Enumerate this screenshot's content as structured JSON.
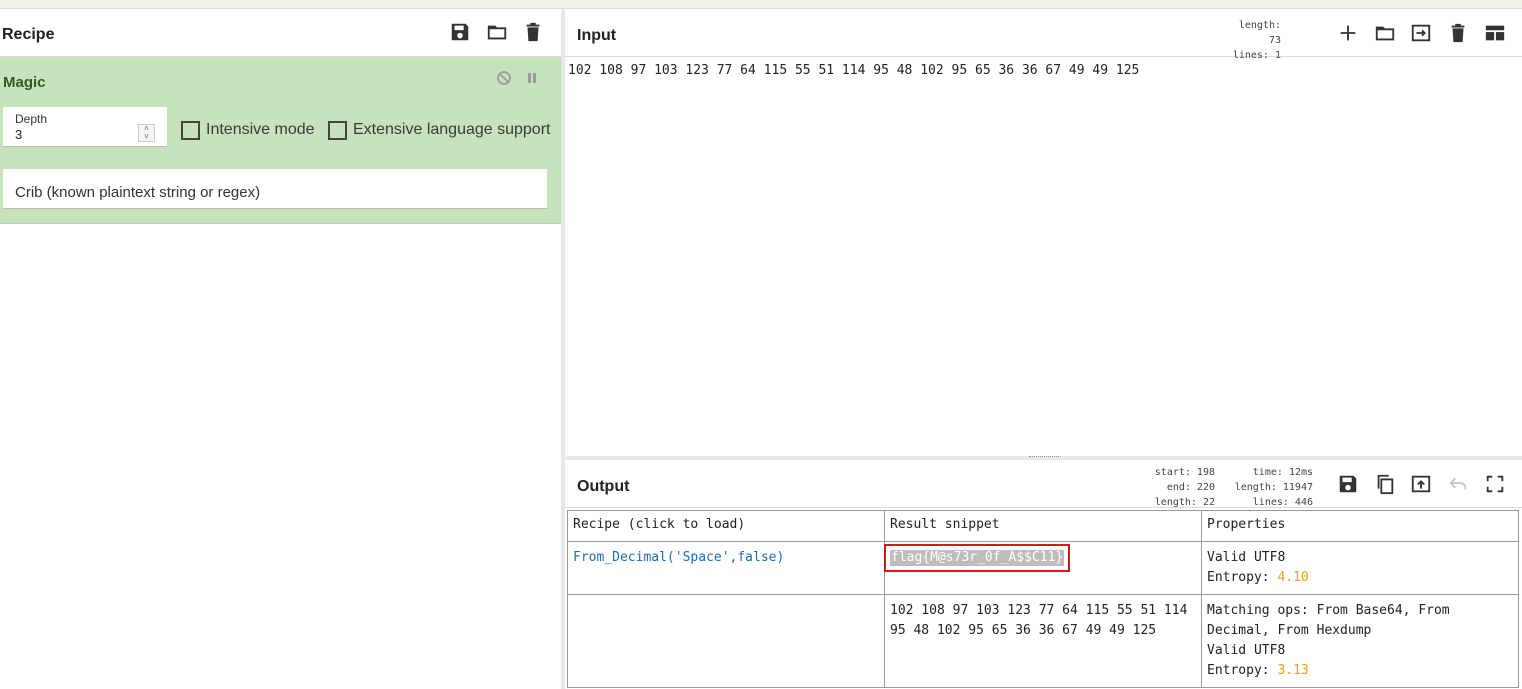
{
  "recipe": {
    "title": "Recipe",
    "icons": [
      "save-icon",
      "folder-icon",
      "trash-icon"
    ],
    "operation": {
      "name": "Magic",
      "depth_label": "Depth",
      "depth_value": "3",
      "intensive_label": "Intensive mode",
      "extensive_label": "Extensive language support",
      "crib_placeholder": "Crib (known plaintext string or regex)"
    }
  },
  "input": {
    "title": "Input",
    "stats": {
      "length": "length: 73",
      "lines": "lines:  1"
    },
    "text": "102 108 97 103 123 77 64 115 55 51 114 95 48 102 95 65 36 36 67 49 49 125"
  },
  "output": {
    "title": "Output",
    "stats_left": {
      "start": "start: 198",
      "end": "end: 220",
      "length": "length:  22"
    },
    "stats_right": {
      "time": "time:  12ms",
      "length": "length: 11947",
      "lines": "lines:   446"
    },
    "table": {
      "headers": [
        "Recipe (click to load)",
        "Result snippet",
        "Properties"
      ],
      "rows": [
        {
          "recipe": "From_Decimal('Space',false)",
          "snippet": "flag{M@s73r_0f_A$$C11}",
          "props_line1": "Valid UTF8",
          "entropy_label": "Entropy:",
          "entropy_value": "4.10"
        },
        {
          "recipe": "",
          "snippet": "102 108 97 103 123 77 64 115 55 51 114 95 48 102 95 65 36 36 67 49 49 125",
          "props_line1": "Matching ops: From Base64, From Decimal, From Hexdump",
          "props_line2": "Valid UTF8",
          "entropy_label": "Entropy:",
          "entropy_value": "3.13"
        }
      ]
    }
  },
  "colors": {
    "accent_green": "#c6e3bb",
    "link_blue": "#1a6fb5",
    "entropy_orange": "#e3a21a",
    "highlight_red": "#d21c1c"
  }
}
